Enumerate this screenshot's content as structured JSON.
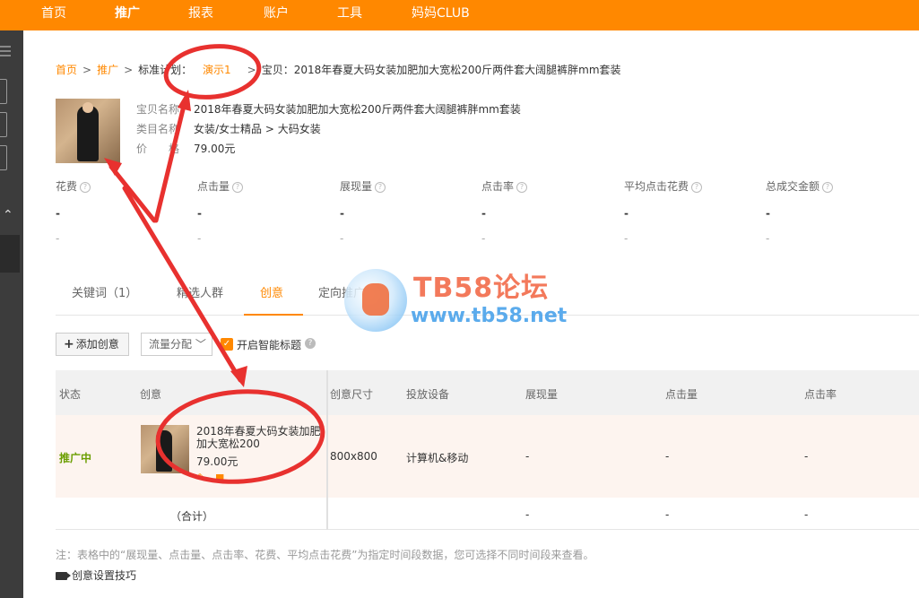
{
  "topnav": {
    "items": [
      "首页",
      "推广",
      "报表",
      "账户",
      "工具",
      "妈妈CLUB"
    ],
    "active_index": 1
  },
  "breadcrumb": {
    "home": "首页",
    "promo": "推广",
    "plan_label": "标准计划：",
    "plan_name": "演示1",
    "item": "宝贝：2018年春夏大码女装加肥加大宽松200斤两件套大阔腿裤胖mm套装"
  },
  "product": {
    "name_label": "宝贝名称",
    "name": "2018年春夏大码女装加肥加大宽松200斤两件套大阔腿裤胖mm套装",
    "category_label": "类目名称",
    "category": "女装/女士精品 > 大码女装",
    "price_label": "价　　格",
    "price": "79.00元"
  },
  "metrics": [
    {
      "label": "花费",
      "value": "-",
      "sub": "-"
    },
    {
      "label": "点击量",
      "value": "-",
      "sub": "-"
    },
    {
      "label": "展现量",
      "value": "-",
      "sub": "-"
    },
    {
      "label": "点击率",
      "value": "-",
      "sub": "-"
    },
    {
      "label": "平均点击花费",
      "value": "-",
      "sub": "-"
    },
    {
      "label": "总成交金额",
      "value": "-",
      "sub": "-"
    }
  ],
  "tabs": [
    "关键词（1）",
    "精选人群",
    "创意",
    "定向推广"
  ],
  "active_tab": 2,
  "toolbar": {
    "add_label": "添加创意",
    "flow_label": "流量分配",
    "smart_title_label": "开启智能标题"
  },
  "table": {
    "headers": [
      "状态",
      "创意",
      "创意尺寸",
      "投放设备",
      "展现量",
      "点击量",
      "点击率"
    ],
    "row": {
      "status": "推广中",
      "title": "2018年春夏大码女装加肥加大宽松200",
      "price": "79.00元",
      "size": "800x800",
      "device": "计算机&移动",
      "impressions": "-",
      "clicks": "-",
      "ctr": "-"
    },
    "total": {
      "label": "（合计）",
      "impressions": "-",
      "clicks": "-",
      "ctr": "-"
    }
  },
  "note": "注：表格中的“展现量、点击量、点击率、花费、平均点击花费”为指定时间段数据，您可选择不同时间段来查看。",
  "tips_label": "创意设置技巧",
  "watermark": {
    "title": "TB58论坛",
    "url": "www.tb58.net"
  },
  "colors": {
    "brand": "#ff8800",
    "status_live": "#6b9e00",
    "annotation": "#e8312f"
  }
}
